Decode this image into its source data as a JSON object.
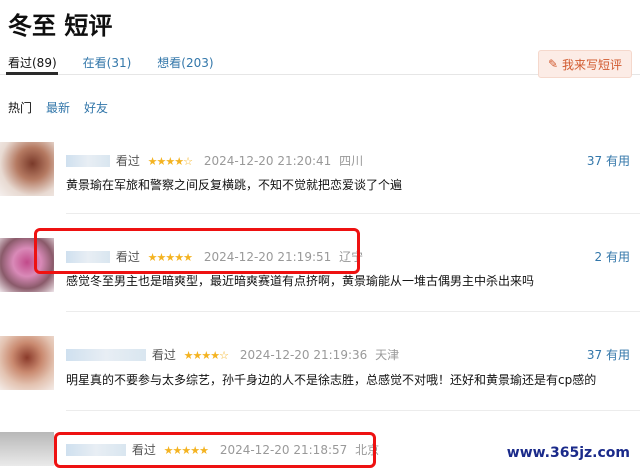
{
  "page_title": "冬至 短评",
  "tabs": [
    {
      "label": "看过(89)"
    },
    {
      "label": "在看(31)"
    },
    {
      "label": "想看(203)"
    }
  ],
  "write_button": {
    "label": "我来写短评",
    "icon": "pencil-icon"
  },
  "sort": [
    {
      "label": "热门"
    },
    {
      "label": "最新"
    },
    {
      "label": "好友"
    }
  ],
  "reviews": [
    {
      "status": "看过",
      "stars": "★★★★☆",
      "rating": 4,
      "time": "2024-12-20 21:20:41",
      "location": "四川",
      "useful": "37 有用",
      "content": "黄景瑜在军旅和警察之间反复横跳，不知不觉就把恋爱谈了个遍"
    },
    {
      "status": "看过",
      "stars": "★★★★★",
      "rating": 5,
      "time": "2024-12-20 21:19:51",
      "location": "辽宁",
      "useful": "2 有用",
      "content": "感觉冬至男主也是暗爽型，最近暗爽赛道有点挤啊，黄景瑜能从一堆古偶男主中杀出来吗"
    },
    {
      "status": "看过",
      "stars": "★★★★☆",
      "rating": 4,
      "time": "2024-12-20 21:19:36",
      "location": "天津",
      "useful": "37 有用",
      "content": "明星真的不要参与太多综艺，孙千身边的人不是徐志胜，总感觉不对哦！还好和黄景瑜还是有cp感的"
    },
    {
      "status": "看过",
      "stars": "★★★★★",
      "rating": 5,
      "time": "2024-12-20 21:18:57",
      "location": "北京",
      "useful": "",
      "content": ""
    }
  ],
  "watermark": "www.365jz.com",
  "colors": {
    "link": "#3377aa",
    "star": "#f4b321",
    "highlight_box": "#ee1111",
    "write_button_bg": "#fcece6"
  }
}
